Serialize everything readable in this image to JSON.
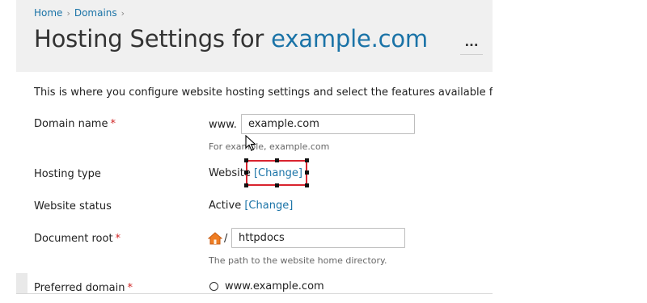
{
  "breadcrumb": {
    "items": [
      "Home",
      "Domains"
    ]
  },
  "title": {
    "prefix": "Hosting Settings for",
    "domain": "example.com",
    "more_label": "..."
  },
  "intro_text": "This is where you configure website hosting settings and select the features available fo",
  "form": {
    "domain_name": {
      "label": "Domain name",
      "required_mark": "*",
      "prefix": "www.",
      "value": "example.com",
      "hint": "For example, example.com"
    },
    "hosting_type": {
      "label": "Hosting type",
      "value": "Website",
      "change_link": "[Change]"
    },
    "website_status": {
      "label": "Website status",
      "value": "Active",
      "change_link": "[Change]"
    },
    "document_root": {
      "label": "Document root",
      "required_mark": "*",
      "home_icon": "home-icon",
      "separator": "/",
      "value": "httpdocs",
      "hint": "The path to the website home directory."
    },
    "preferred_domain": {
      "label": "Preferred domain",
      "required_mark": "*",
      "option": "www.example.com"
    }
  },
  "colors": {
    "link": "#1a73a7",
    "required": "#d02424",
    "header_bg": "#f0f0f0",
    "highlight": "#d9232e"
  }
}
